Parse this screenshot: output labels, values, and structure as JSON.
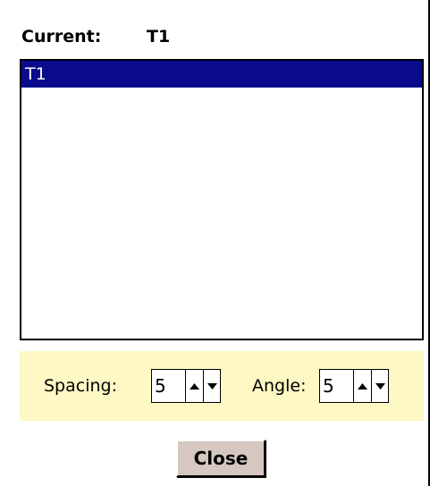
{
  "header": {
    "current_label": "Current:",
    "current_value": "T1"
  },
  "list": {
    "items": [
      {
        "label": "T1",
        "selected": true
      }
    ]
  },
  "controls": {
    "spacing_label": "Spacing:",
    "spacing_value": "5",
    "angle_label": "Angle:",
    "angle_value": "5"
  },
  "footer": {
    "close_label": "Close"
  },
  "colors": {
    "selection": "#0a0a8c",
    "panel_background": "#fdf8c4",
    "button_face": "#d6c8c1"
  },
  "icons": {
    "spin_up": "triangle-up-icon",
    "spin_down": "triangle-down-icon"
  }
}
